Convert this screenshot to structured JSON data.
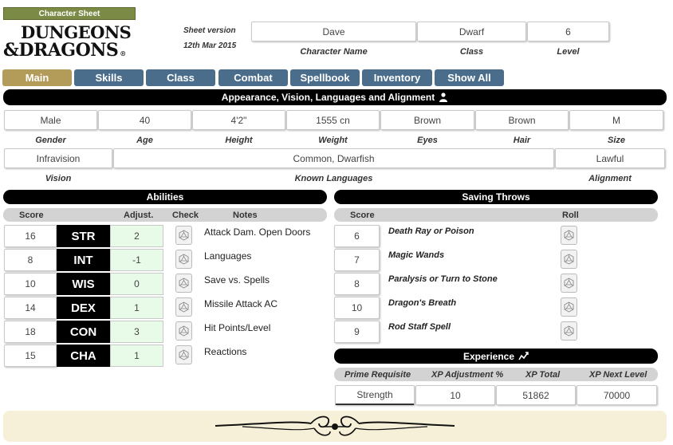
{
  "header": {
    "badge": "Character Sheet",
    "logo_line1": "DUNGEONS",
    "logo_line2": "&DRAGONS",
    "logo_mark": "®",
    "sheet_version_label": "Sheet version",
    "sheet_version_date": "12th Mar 2015"
  },
  "character": {
    "name": "Dave",
    "name_label": "Character Name",
    "class": "Dwarf",
    "class_label": "Class",
    "level": "6",
    "level_label": "Level"
  },
  "tabs": [
    "Main",
    "Skills",
    "Class",
    "Combat",
    "Spellbook",
    "Inventory",
    "Show All"
  ],
  "appearance": {
    "title": "Appearance, Vision, Languages and Alignment",
    "fields": [
      {
        "label": "Gender",
        "value": "Male"
      },
      {
        "label": "Age",
        "value": "40"
      },
      {
        "label": "Height",
        "value": "4'2\""
      },
      {
        "label": "Weight",
        "value": "1555 cn"
      },
      {
        "label": "Eyes",
        "value": "Brown"
      },
      {
        "label": "Hair",
        "value": "Brown"
      },
      {
        "label": "Size",
        "value": "M"
      }
    ],
    "vision": {
      "label": "Vision",
      "value": "Infravision"
    },
    "languages": {
      "label": "Known Languages",
      "value": "Common, Dwarfish"
    },
    "alignment": {
      "label": "Alignment",
      "value": "Lawful"
    }
  },
  "abilities": {
    "title": "Abilities",
    "headers": {
      "score": "Score",
      "adjust": "Adjust.",
      "check": "Check",
      "notes": "Notes"
    },
    "rows": [
      {
        "score": "16",
        "abbr": "STR",
        "adjust": "2",
        "note": "Attack Dam. Open Doors"
      },
      {
        "score": "8",
        "abbr": "INT",
        "adjust": "-1",
        "note": "Languages"
      },
      {
        "score": "10",
        "abbr": "WIS",
        "adjust": "0",
        "note": "Save vs. Spells"
      },
      {
        "score": "14",
        "abbr": "DEX",
        "adjust": "1",
        "note": "Missile Attack AC"
      },
      {
        "score": "18",
        "abbr": "CON",
        "adjust": "3",
        "note": "Hit Points/Level"
      },
      {
        "score": "15",
        "abbr": "CHA",
        "adjust": "1",
        "note": "Reactions"
      }
    ]
  },
  "saving_throws": {
    "title": "Saving Throws",
    "headers": {
      "score": "Score",
      "roll": "Roll"
    },
    "rows": [
      {
        "score": "6",
        "name": "Death Ray or Poison"
      },
      {
        "score": "7",
        "name": "Magic Wands"
      },
      {
        "score": "8",
        "name": "Paralysis or Turn to Stone"
      },
      {
        "score": "10",
        "name": "Dragon's Breath"
      },
      {
        "score": "9",
        "name": "Rod Staff Spell"
      }
    ]
  },
  "experience": {
    "title": "Experience",
    "headers": {
      "prime": "Prime Requisite",
      "adjust": "XP Adjustment %",
      "total": "XP Total",
      "next": "XP Next Level"
    },
    "prime": "Strength",
    "adjust": "10",
    "total": "51862",
    "next": "70000"
  },
  "icons": {
    "appearance": "person-icon",
    "experience": "chart-icon",
    "dice": "d20-dice-icon"
  },
  "colors": {
    "badge": "#7b8a45",
    "tab": "#4a6d8c",
    "tab_active": "#b39b5a",
    "adjust_bg": "#e8fae8",
    "footer": "#f7f0d9"
  }
}
